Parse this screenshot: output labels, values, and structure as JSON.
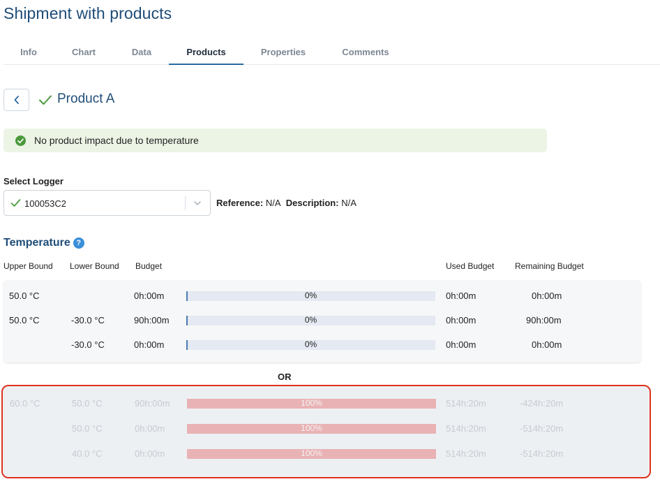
{
  "page": {
    "title": "Shipment with products"
  },
  "tabs": [
    {
      "label": "Info",
      "active": false
    },
    {
      "label": "Chart",
      "active": false
    },
    {
      "label": "Data",
      "active": false
    },
    {
      "label": "Products",
      "active": true
    },
    {
      "label": "Properties",
      "active": false
    },
    {
      "label": "Comments",
      "active": false
    }
  ],
  "product": {
    "name": "Product A",
    "status_icon": "check-icon",
    "back_icon": "chevron-left-icon"
  },
  "impact": {
    "text": "No product impact due to temperature",
    "icon": "check-circle-icon",
    "color": "#4a9a3c"
  },
  "logger": {
    "label": "Select Logger",
    "value": "100053C2",
    "reference_label": "Reference:",
    "reference_value": "N/A",
    "description_label": "Description:",
    "description_value": "N/A"
  },
  "temperature": {
    "title": "Temperature",
    "help_icon": "?",
    "columns": {
      "upper": "Upper Bound",
      "lower": "Lower Bound",
      "budget": "Budget",
      "used": "Used Budget",
      "remaining": "Remaining Budget"
    },
    "rows": [
      {
        "upper": "50.0 °C",
        "lower": "",
        "budget": "0h:00m",
        "percent_label": "0%",
        "percent": 0,
        "used": "0h:00m",
        "remaining": "0h:00m"
      },
      {
        "upper": "50.0 °C",
        "lower": "-30.0 °C",
        "budget": "90h:00m",
        "percent_label": "0%",
        "percent": 0,
        "used": "0h:00m",
        "remaining": "90h:00m"
      },
      {
        "upper": "",
        "lower": "-30.0 °C",
        "budget": "0h:00m",
        "percent_label": "0%",
        "percent": 0,
        "used": "0h:00m",
        "remaining": "0h:00m"
      }
    ],
    "or_label": "OR",
    "alt_rows": [
      {
        "upper": "60.0 °C",
        "lower": "50.0 °C",
        "budget": "90h:00m",
        "percent_label": "100%",
        "percent": 100,
        "used": "514h:20m",
        "remaining": "-424h:20m"
      },
      {
        "upper": "",
        "lower": "50.0 °C",
        "budget": "0h:00m",
        "percent_label": "100%",
        "percent": 100,
        "used": "514h:20m",
        "remaining": "-514h:20m"
      },
      {
        "upper": "",
        "lower": "40.0 °C",
        "budget": "0h:00m",
        "percent_label": "100%",
        "percent": 100,
        "used": "514h:20m",
        "remaining": "-514h:20m"
      }
    ]
  },
  "colors": {
    "accent": "#1f4d78",
    "tab_active": "#2c6aa0",
    "success_bg": "#ecf4e5",
    "alert_border": "#e0311d",
    "bar_exceeded": "#e9b2b4"
  }
}
